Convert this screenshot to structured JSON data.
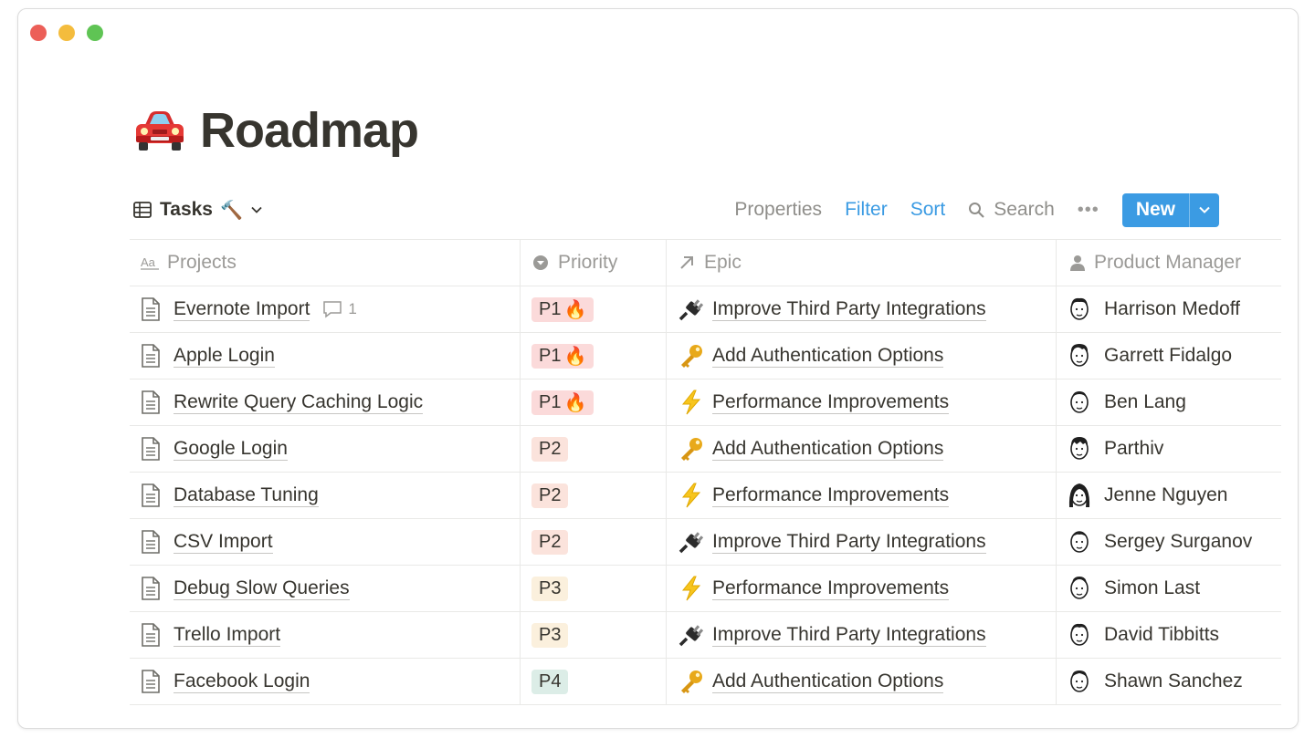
{
  "page": {
    "title": "Roadmap",
    "icon": "car-icon"
  },
  "toolbar": {
    "view_label": "Tasks",
    "view_emoji": "🔨",
    "properties": "Properties",
    "filter": "Filter",
    "sort": "Sort",
    "search": "Search",
    "more": "•••",
    "new": "New"
  },
  "columns": {
    "projects": "Projects",
    "priority": "Priority",
    "epic": "Epic",
    "pm": "Product Manager"
  },
  "colors": {
    "accent": "#3b9be3",
    "p1": "#fbdada",
    "p2": "#fbe3dc",
    "p3": "#fbf0dd",
    "p4": "#dcede7"
  },
  "rows": [
    {
      "project": "Evernote Import",
      "comments": "1",
      "priority": "P1",
      "fire": "🔥",
      "epic_icon": "plug-icon",
      "epic": "Improve Third Party Integrations",
      "pm": "Harrison Medoff"
    },
    {
      "project": "Apple Login",
      "comments": "",
      "priority": "P1",
      "fire": "🔥",
      "epic_icon": "key-icon",
      "epic": "Add Authentication Options",
      "pm": "Garrett Fidalgo"
    },
    {
      "project": "Rewrite Query Caching Logic",
      "comments": "",
      "priority": "P1",
      "fire": "🔥",
      "epic_icon": "lightning-icon",
      "epic": "Performance Improvements",
      "pm": "Ben Lang"
    },
    {
      "project": "Google Login",
      "comments": "",
      "priority": "P2",
      "fire": "",
      "epic_icon": "key-icon",
      "epic": "Add Authentication Options",
      "pm": "Parthiv"
    },
    {
      "project": "Database Tuning",
      "comments": "",
      "priority": "P2",
      "fire": "",
      "epic_icon": "lightning-icon",
      "epic": "Performance Improvements",
      "pm": "Jenne Nguyen"
    },
    {
      "project": "CSV Import",
      "comments": "",
      "priority": "P2",
      "fire": "",
      "epic_icon": "plug-icon",
      "epic": "Improve Third Party Integrations",
      "pm": "Sergey Surganov"
    },
    {
      "project": "Debug Slow Queries",
      "comments": "",
      "priority": "P3",
      "fire": "",
      "epic_icon": "lightning-icon",
      "epic": "Performance Improvements",
      "pm": "Simon Last"
    },
    {
      "project": "Trello Import",
      "comments": "",
      "priority": "P3",
      "fire": "",
      "epic_icon": "plug-icon",
      "epic": "Improve Third Party Integrations",
      "pm": "David Tibbitts"
    },
    {
      "project": "Facebook Login",
      "comments": "",
      "priority": "P4",
      "fire": "",
      "epic_icon": "key-icon",
      "epic": "Add Authentication Options",
      "pm": "Shawn Sanchez"
    }
  ]
}
